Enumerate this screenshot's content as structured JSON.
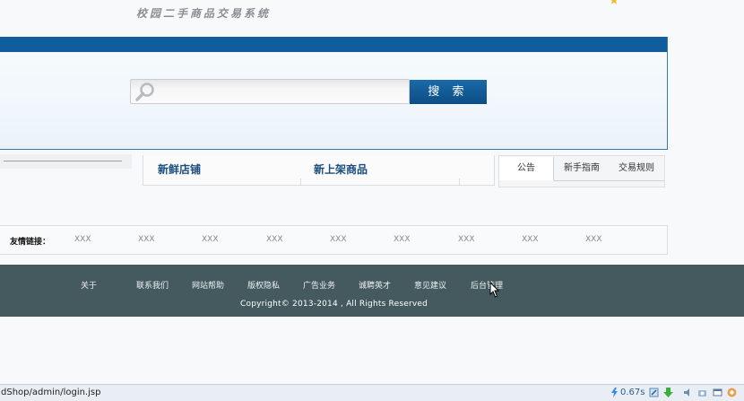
{
  "header": {
    "site_title": "校园二手商品交易系统"
  },
  "search": {
    "placeholder": "",
    "button_label": "搜 索"
  },
  "shops": {
    "new_shops_title": "新鲜店铺",
    "new_goods_title": "新上架商品"
  },
  "notice_tabs": [
    "公告",
    "新手指南",
    "交易规则"
  ],
  "friend_links": {
    "label": "友情链接：",
    "items": [
      "XXX",
      "XXX",
      "XXX",
      "XXX",
      "XXX",
      "XXX",
      "XXX",
      "XXX",
      "XXX"
    ]
  },
  "footer": {
    "links": [
      "关于",
      "联系我们",
      "网站帮助",
      "版权隐私",
      "广告业务",
      "诚聘英才",
      "意见建议",
      "后台管理"
    ],
    "copyright": "Copyright©   2013-2014 , All  Rights  Reserved"
  },
  "status_bar": {
    "url": "dShop/admin/login.jsp",
    "timing": "0.67s"
  },
  "colors": {
    "brand_blue": "#0f5d9c",
    "footer_bg": "#455a5f",
    "title_blue": "#1a4c7d"
  }
}
